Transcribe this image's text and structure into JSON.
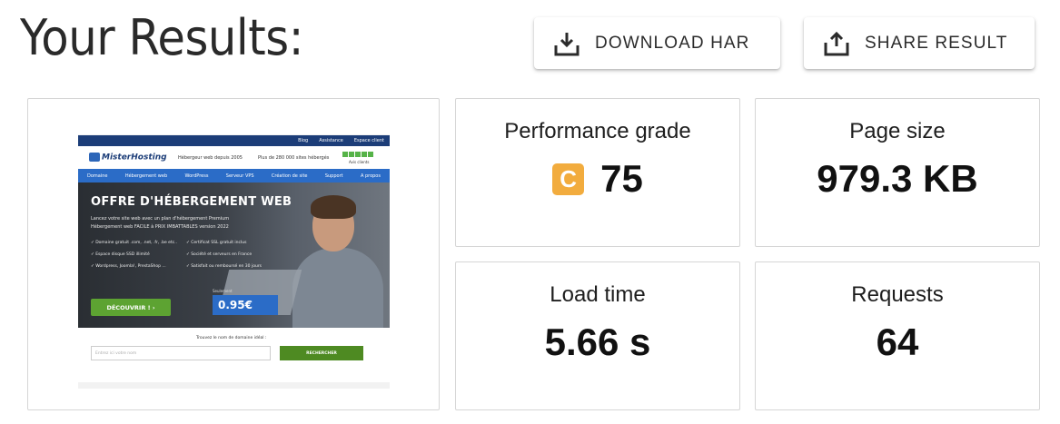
{
  "page": {
    "title": "Your Results:"
  },
  "actions": {
    "download_label": "DOWNLOAD HAR",
    "download_icon": "download-icon",
    "share_label": "SHARE RESULT",
    "share_icon": "share-icon"
  },
  "metrics": {
    "performance": {
      "label": "Performance grade",
      "grade": "C",
      "score": "75",
      "badge_color": "#f2ac3e"
    },
    "page_size": {
      "label": "Page size",
      "value": "979.3 KB"
    },
    "load_time": {
      "label": "Load time",
      "value": "5.66 s"
    },
    "requests": {
      "label": "Requests",
      "value": "64"
    }
  },
  "screenshot": {
    "topbar_links": [
      "Blog",
      "Assistance",
      "Espace client"
    ],
    "brand": "MisterHosting",
    "tagline": "Hébergeur web depuis 2005",
    "tagline2": "Plus de 280 000 sites hébergés",
    "reviews": "Avis clients",
    "nav": [
      "Domaine",
      "Hébergement web",
      "WordPress",
      "Serveur VPS",
      "Création de site",
      "Support",
      "A propos"
    ],
    "hero_title": "OFFRE D'HÉBERGEMENT WEB",
    "hero_text": "Lancez votre site web avec un plan d'hébergement Premium Hébergement web FACILE à PRIX IMBATTABLES version 2022",
    "features": [
      "Domaine gratuit .com, .net, .fr, .be etc..",
      "Certificat SSL gratuit inclus",
      "Espace disque SSD illimité",
      "Société et serveurs en France",
      "Wordpress, Joomla!, PrestaShop ...",
      "Satisfait ou remboursé en 30 jours"
    ],
    "cta": "DÉCOUVRIR !",
    "price_label": "Seulement",
    "price": "0.95€",
    "search_label": "Trouvez le nom de domaine idéal :",
    "search_placeholder": "Entrez ici votre nom",
    "search_button": "RECHERCHER"
  }
}
